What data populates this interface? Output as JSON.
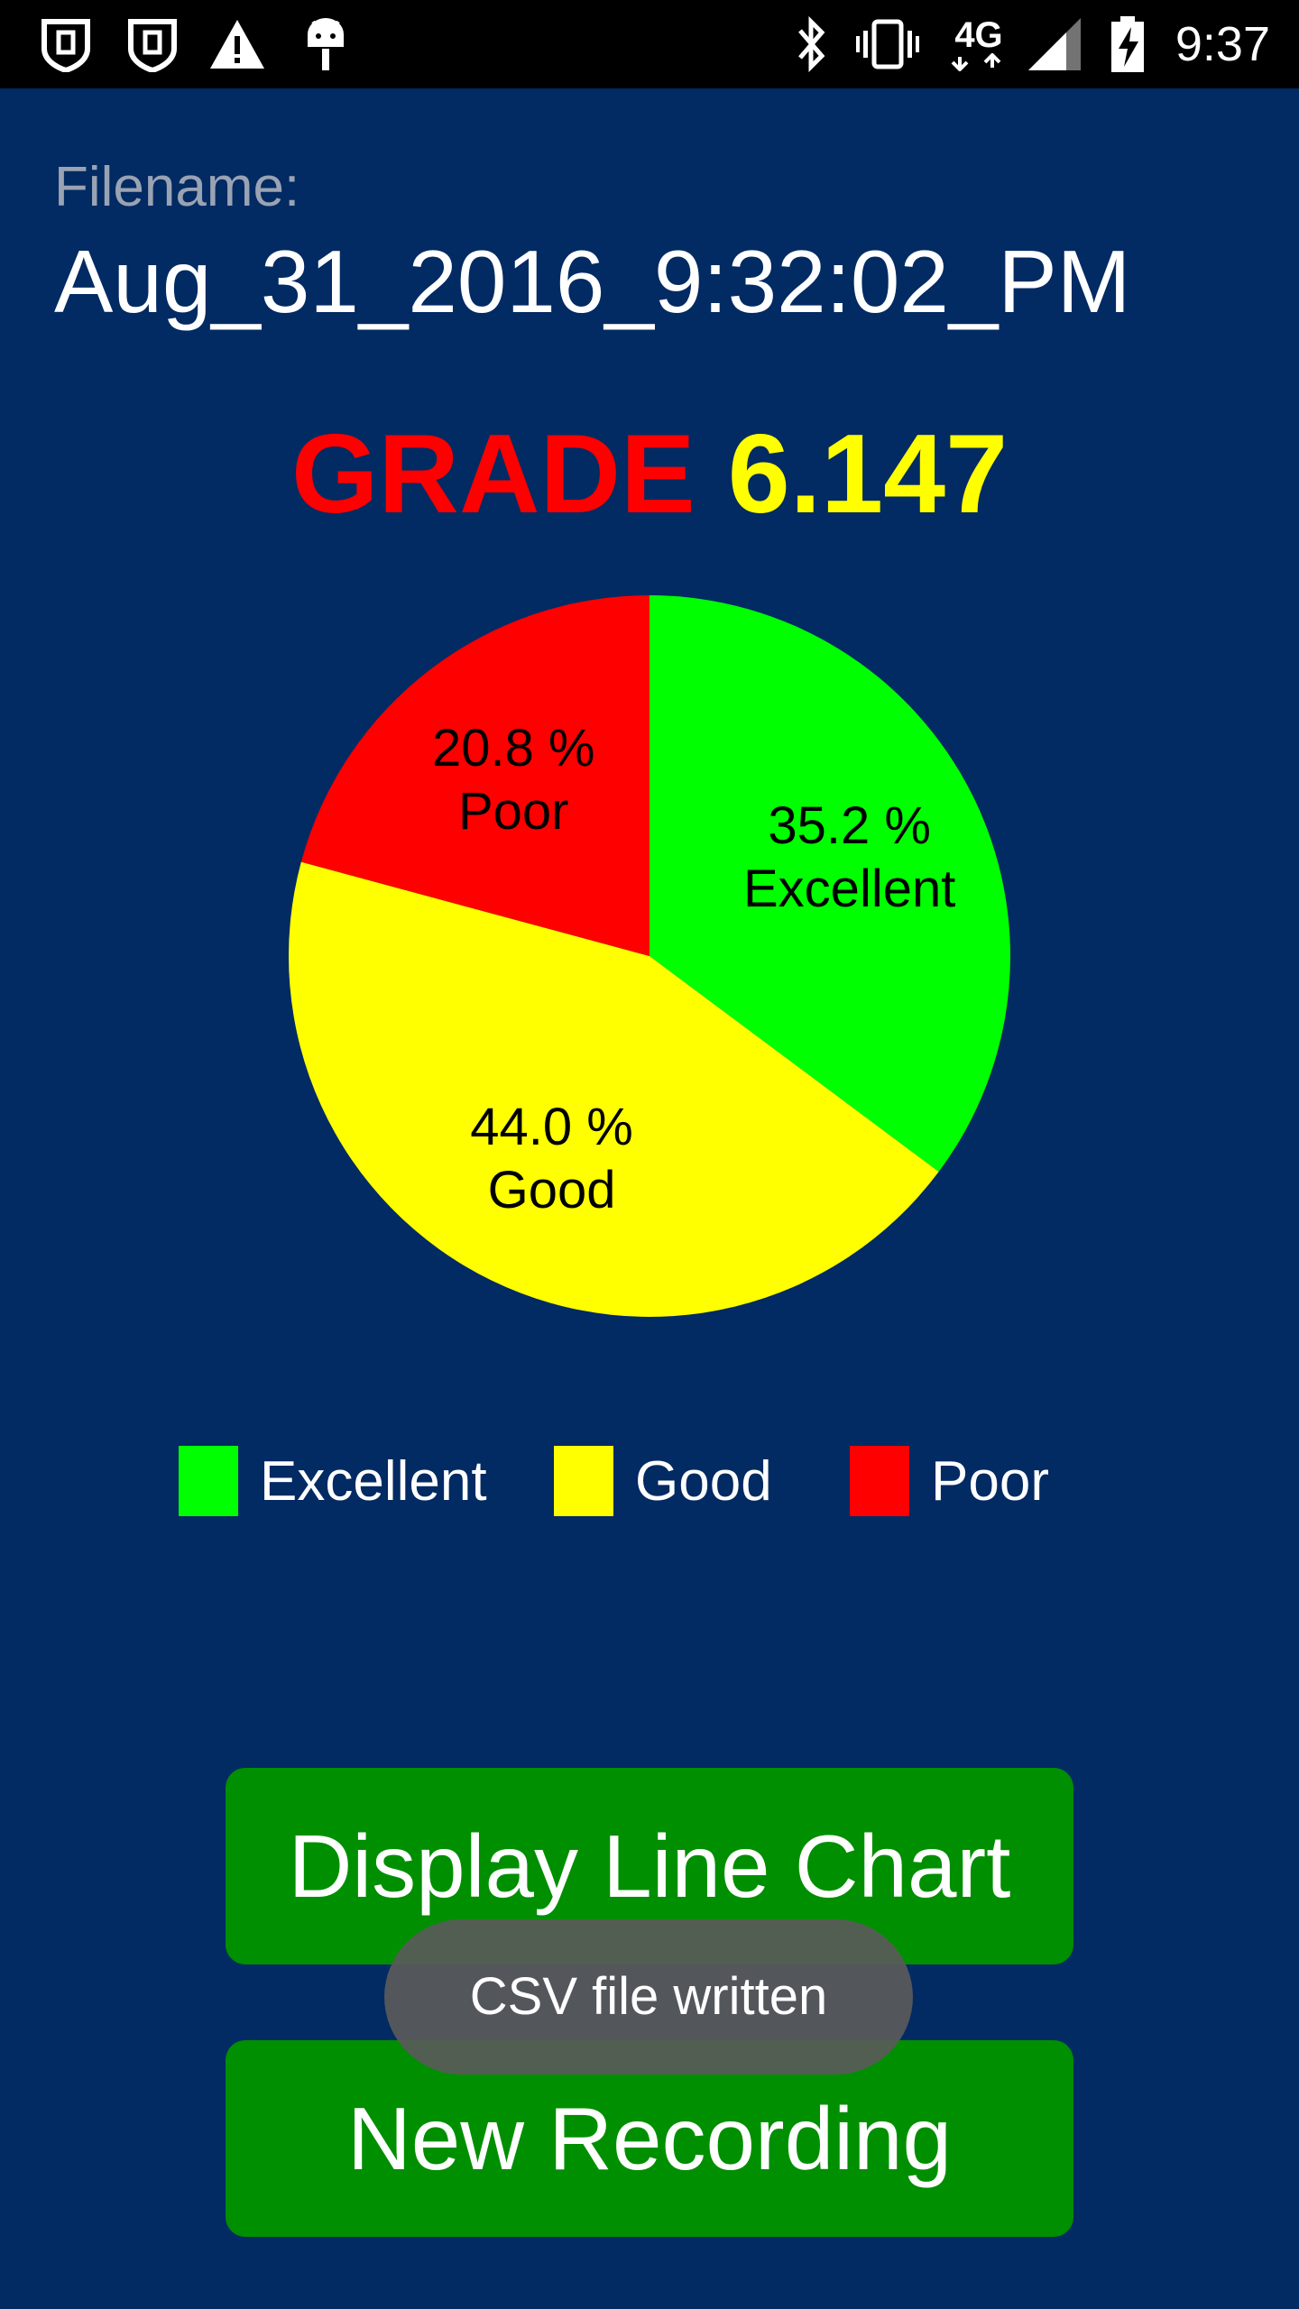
{
  "status_bar": {
    "time": "9:37",
    "network_label": "4G",
    "icons": [
      "shield-icon",
      "shield-icon",
      "warning-icon",
      "android-debug-icon",
      "bluetooth-icon",
      "vibrate-icon",
      "lte-icon",
      "signal-icon",
      "battery-charging-icon"
    ]
  },
  "file": {
    "label": "Filename:",
    "value": "Aug_31_2016_9:32:02_PM"
  },
  "grade": {
    "label": "GRADE",
    "value": "6.147"
  },
  "chart_data": {
    "type": "pie",
    "slices": [
      {
        "name": "Excellent",
        "value": 35.2,
        "label": "35.2 %",
        "color": "#00ff00"
      },
      {
        "name": "Good",
        "value": 44.0,
        "label": "44.0 %",
        "color": "#ffff00"
      },
      {
        "name": "Poor",
        "value": 20.8,
        "label": "20.8 %",
        "color": "#ff0000"
      }
    ],
    "legend_placement": "bottom"
  },
  "buttons": {
    "line_chart": "Display Line Chart",
    "new_recording": "New Recording"
  },
  "toast": {
    "message": "CSV file written"
  },
  "colors": {
    "background": "#022a63",
    "button": "#008f00",
    "grade_label": "#ff0000",
    "grade_value": "#ffff00"
  }
}
